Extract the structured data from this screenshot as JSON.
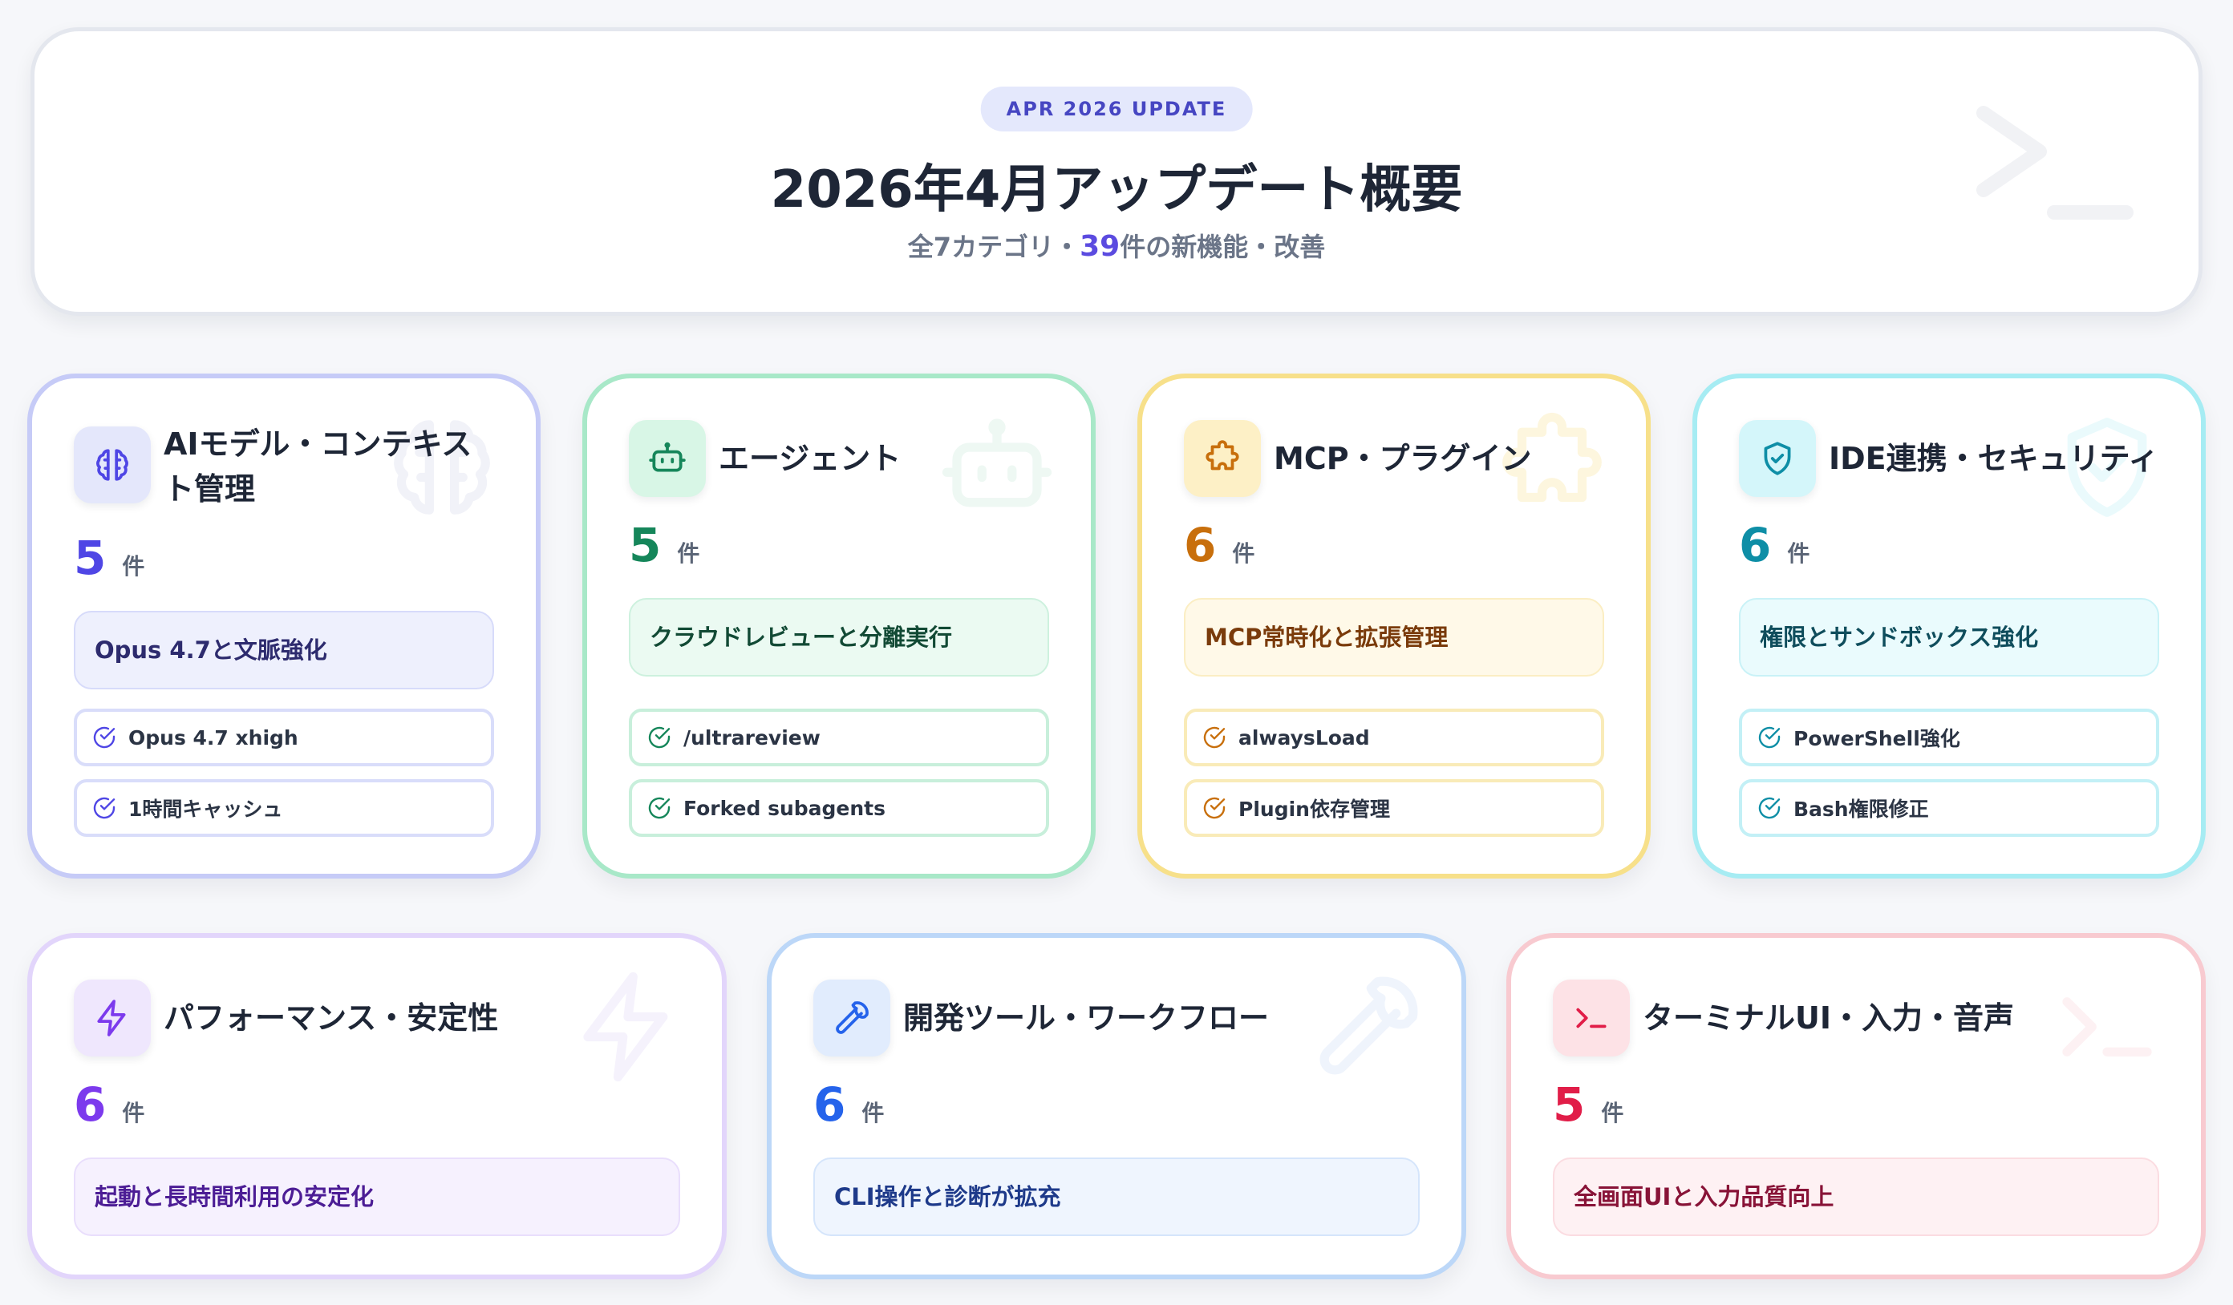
{
  "header": {
    "badge": "APR 2026 UPDATE",
    "title": "2026年4月アップデート概要",
    "subtitle_prefix": "全7カテゴリ・",
    "subtitle_count": "39",
    "subtitle_suffix": "件の新機能・改善"
  },
  "count_unit": "件",
  "categories": [
    {
      "icon": "brain-icon",
      "title": "AIモデル・コンテキスト管理",
      "count": "5",
      "summary": "Opus 4.7と文脈強化",
      "features": [
        "Opus 4.7 xhigh",
        "1時間キャッシュ"
      ],
      "colors": {
        "border": "#c6cbf7",
        "accent": "#4f46e5",
        "icon_bg": "#e4e7fb",
        "summary_bg": "#eef0fd",
        "summary_border": "#d7dbfa",
        "summary_text": "#2d2b6e",
        "feature_border": "#d9ddfa"
      }
    },
    {
      "icon": "robot-icon",
      "title": "エージェント",
      "count": "5",
      "summary": "クラウドレビューと分離実行",
      "features": [
        "/ultrareview",
        "Forked subagents"
      ],
      "colors": {
        "border": "#a8e8c8",
        "accent": "#15865a",
        "icon_bg": "#d8f6e6",
        "summary_bg": "#ebfaf2",
        "summary_border": "#cdf1de",
        "summary_text": "#124a35",
        "feature_border": "#c8efdb"
      }
    },
    {
      "icon": "puzzle-icon",
      "title": "MCP・プラグイン",
      "count": "6",
      "summary": "MCP常時化と拡張管理",
      "features": [
        "alwaysLoad",
        "Plugin依存管理"
      ],
      "colors": {
        "border": "#f7e08a",
        "accent": "#c86f0c",
        "icon_bg": "#fdf0c6",
        "summary_bg": "#fff9e8",
        "summary_border": "#fbeec3",
        "summary_text": "#7a3b0b",
        "feature_border": "#f9ebb8"
      }
    },
    {
      "icon": "shield-icon",
      "title": "IDE連携・セキュリティ",
      "count": "6",
      "summary": "権限とサンドボックス強化",
      "features": [
        "PowerShell強化",
        "Bash権限修正"
      ],
      "colors": {
        "border": "#a6ecf3",
        "accent": "#0e8ea6",
        "icon_bg": "#d4f6fa",
        "summary_bg": "#eafbfd",
        "summary_border": "#c9f2f7",
        "summary_text": "#0f4d5c",
        "feature_border": "#c3f0f6"
      }
    },
    {
      "icon": "bolt-icon",
      "title": "パフォーマンス・安定性",
      "count": "6",
      "summary": "起動と長時間利用の安定化",
      "features": [],
      "colors": {
        "border": "#e2d5fb",
        "accent": "#7c3aed",
        "icon_bg": "#efe7fd",
        "summary_bg": "#f6f1fe",
        "summary_border": "#e9defc",
        "summary_text": "#4c1d95",
        "feature_border": "#e2d5fb"
      }
    },
    {
      "icon": "wrench-icon",
      "title": "開発ツール・ワークフロー",
      "count": "6",
      "summary": "CLI操作と診断が拡充",
      "features": [],
      "colors": {
        "border": "#bcd7f8",
        "accent": "#2563eb",
        "icon_bg": "#e1ecfd",
        "summary_bg": "#eff5fe",
        "summary_border": "#d5e5fb",
        "summary_text": "#1e3a8a",
        "feature_border": "#bcd7f8"
      }
    },
    {
      "icon": "terminal-icon",
      "title": "ターミナルUI・入力・音声",
      "count": "5",
      "summary": "全画面UIと入力品質向上",
      "features": [],
      "colors": {
        "border": "#f8cad0",
        "accent": "#e11d48",
        "icon_bg": "#fde2e6",
        "summary_bg": "#fef1f3",
        "summary_border": "#fbdce1",
        "summary_text": "#881337",
        "feature_border": "#f8cad0"
      }
    }
  ]
}
